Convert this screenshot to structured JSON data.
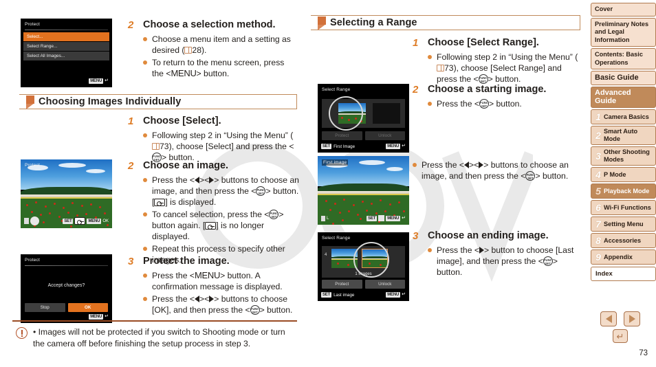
{
  "page": {
    "number": "73"
  },
  "left_column": {
    "shot_protect_menu": {
      "title": "Protect",
      "items": [
        "Select...",
        "Select Range...",
        "Select All Images..."
      ],
      "selected_index": 0,
      "menu_chip": "MENU",
      "return_glyph": "↲"
    },
    "step2_top": {
      "number": "2",
      "title": "Choose a selection method.",
      "bullets": [
        {
          "pre": "Choose a menu item and a setting as desired (",
          "ref": "28",
          "post": ")."
        },
        {
          "pre": "To return to the menu screen, press the <",
          "key": "MENU",
          "post": "> button."
        }
      ]
    },
    "section_header": "Choosing Images Individually",
    "step1": {
      "number": "1",
      "title": "Choose [Select].",
      "bullets": [
        {
          "line1": "Following step 2 in “Using the Menu”",
          "ref": "73",
          "line2": "), choose [Select] and press the",
          "line3": "> button."
        }
      ]
    },
    "shot_protect_photo": {
      "label": "Protect",
      "set_chip": "SET",
      "menu_chip": "MENU",
      "ok_text": "OK"
    },
    "step2": {
      "number": "2",
      "title": "Choose an image.",
      "bullets": [
        "Press the <◀><▶> buttons to choose an image, and then press the <FUNC/SET> button. [key] is displayed.",
        "To cancel selection, press the <FUNC/SET> button again. [key] is no longer displayed.",
        "Repeat this process to specify other images."
      ]
    },
    "shot_confirm": {
      "title": "Protect",
      "message": "Accept changes?",
      "buttons": [
        "Stop",
        "OK"
      ],
      "selected_button": "OK",
      "menu_chip": "MENU"
    },
    "step3": {
      "number": "3",
      "title": "Protect the image.",
      "bullets": [
        "Press the <MENU> button. A confirmation message is displayed.",
        "Press the <◀><▶> buttons to choose [OK], and then press the <FUNC/SET> button."
      ]
    },
    "note": {
      "text": "Images will not be protected if you switch to Shooting mode or turn the camera off before finishing the setup process in step 3."
    }
  },
  "right_column": {
    "section_header": "Selecting a Range",
    "step1": {
      "number": "1",
      "title": "Choose [Select Range].",
      "bullet_line1": "Following step 2 in “Using the Menu”",
      "bullet_ref": "73",
      "bullet_line2": "), choose [Select Range] and",
      "bullet_line3": "press the <FUNC/SET> button."
    },
    "step2": {
      "number": "2",
      "title": "Choose a starting image.",
      "bullet": "Press the <FUNC/SET> button."
    },
    "shot_select_range_first": {
      "label": "Select Range",
      "buttons": [
        "Protect",
        "Unlock"
      ],
      "set_chip": "SET",
      "set_label": "First Image",
      "menu_chip": "MENU"
    },
    "shot_first_image": {
      "label": "First image",
      "set_chip": "SET",
      "menu_chip": "MENU"
    },
    "bullet_choose_image": "Press the <◀><▶> buttons to choose an image, and then press the <FUNC/SET> button.",
    "step3": {
      "number": "3",
      "title": "Choose an ending image.",
      "bullet": "Press the <▶> button to choose [Last image], and then press the <FUNC/SET> button."
    },
    "shot_select_range_last": {
      "label": "Select Range",
      "count_text": "1 images",
      "index_text": "4",
      "buttons": [
        "Protect",
        "Unlock"
      ],
      "set_chip": "SET",
      "set_label": "Last image",
      "menu_chip": "MENU"
    }
  },
  "sidebar": {
    "items": [
      {
        "label": "Cover",
        "type": "plain"
      },
      {
        "label": "Preliminary Notes and Legal Information",
        "type": "plain"
      },
      {
        "label": "Contents: Basic Operations",
        "type": "plain"
      },
      {
        "label": "Basic Guide",
        "type": "large"
      },
      {
        "label": "Advanced Guide",
        "type": "advanced"
      }
    ],
    "chapters": [
      {
        "num": "1",
        "label": "Camera Basics",
        "active": false
      },
      {
        "num": "2",
        "label": "Smart Auto Mode",
        "active": false
      },
      {
        "num": "3",
        "label": "Other Shooting Modes",
        "active": false
      },
      {
        "num": "4",
        "label": "P Mode",
        "active": false
      },
      {
        "num": "5",
        "label": "Playback Mode",
        "active": true
      },
      {
        "num": "6",
        "label": "Wi-Fi Functions",
        "active": false
      },
      {
        "num": "7",
        "label": "Setting Menu",
        "active": false
      },
      {
        "num": "8",
        "label": "Accessories",
        "active": false
      },
      {
        "num": "9",
        "label": "Appendix",
        "active": false
      }
    ],
    "index_label": "Index"
  },
  "pager": {
    "prev_label": "previous-page",
    "next_label": "next-page",
    "home_label": "back"
  },
  "colors": {
    "accent_orange": "#de7c26",
    "brand_brown": "#c08a5a",
    "panel_peach": "#f6e0cf",
    "highlight_orange": "#e2721f"
  }
}
